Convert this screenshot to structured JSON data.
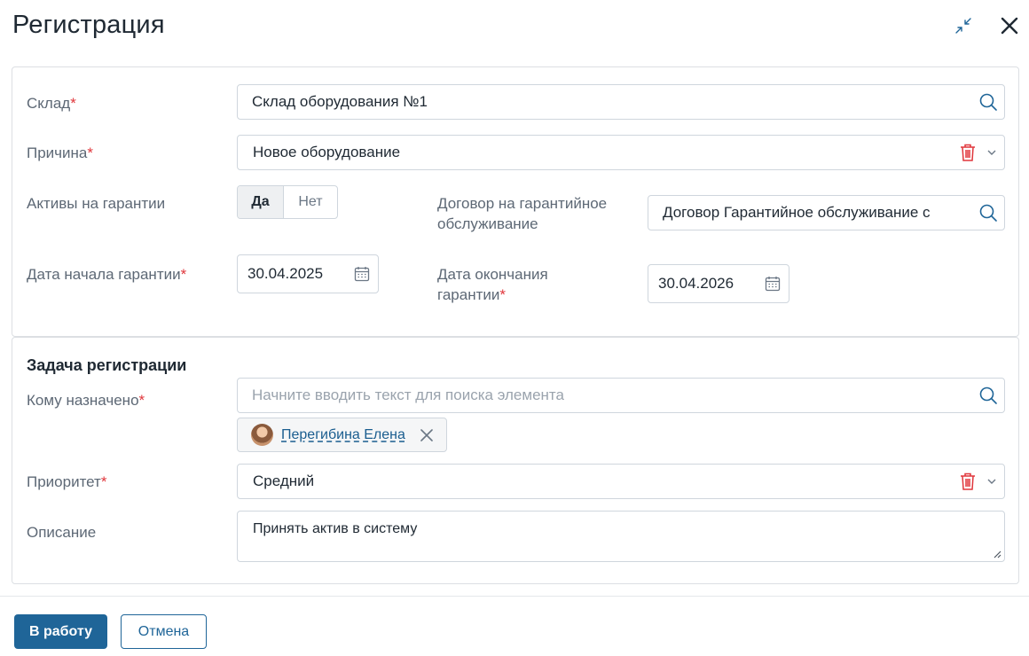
{
  "window": {
    "title": "Регистрация"
  },
  "icons": {
    "minimize": "collapse-arrows-icon",
    "close": "close-icon",
    "search": "search-icon",
    "delete": "trash-icon",
    "dropdown": "chevron-down-icon",
    "calendar": "calendar-icon"
  },
  "colors": {
    "accent": "#1f6598",
    "required": "#e0363b",
    "delete": "#e0363b"
  },
  "main": {
    "warehouse": {
      "label": "Склад",
      "value": "Склад оборудования №1"
    },
    "reason": {
      "label": "Причина",
      "value": "Новое оборудование"
    },
    "warranty": {
      "label": "Активы на гарантии",
      "yes": "Да",
      "no": "Нет",
      "selected": "Да"
    },
    "contract": {
      "label": "Договор на гарантийное обслуживание",
      "value": "Договор Гарантийное обслуживание с"
    },
    "start_date": {
      "label": "Дата начала гарантии",
      "value": "30.04.2025"
    },
    "end_date": {
      "label_line1": "Дата окончания",
      "label_line2": "гарантии",
      "value": "30.04.2026"
    }
  },
  "task": {
    "title": "Задача регистрации",
    "assignee": {
      "label": "Кому назначено",
      "placeholder": "Начните вводить текст для поиска элемента",
      "selected_user": "Перегибина Елена"
    },
    "priority": {
      "label": "Приоритет",
      "value": "Средний"
    },
    "description": {
      "label": "Описание",
      "value": "Принять актив в систему"
    }
  },
  "required_mark": "*",
  "footer": {
    "submit": "В работу",
    "cancel": "Отмена"
  }
}
